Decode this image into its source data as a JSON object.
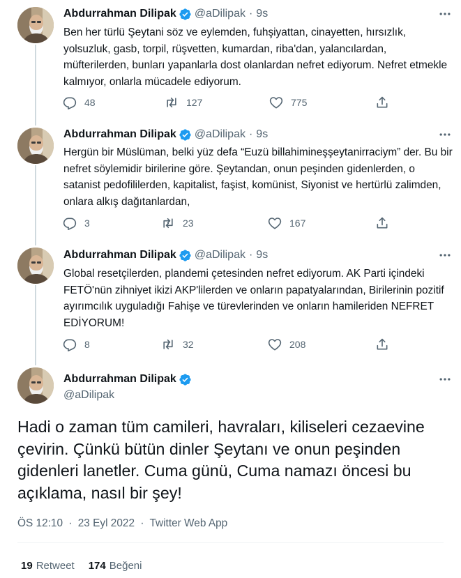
{
  "author": {
    "name": "Abdurrahman Dilipak",
    "handle": "@aDilipak"
  },
  "colors": {
    "verified": "#1d9bf0",
    "text_primary": "#0f1419",
    "text_secondary": "#536471",
    "divider": "#eff3f4",
    "thread_line": "#cfd9de"
  },
  "tweets": [
    {
      "time": "9s",
      "text": "Ben her türlü Şeytani söz ve eylemden, fuhşiyattan, cinayetten, hırsızlık, yolsuzluk, gasb, torpil, rüşvetten, kumardan, riba'dan, yalancılardan, müfterilerden,  bunları yapanlarla dost olanlardan nefret ediyorum. Nefret etmekle kalmıyor, onlarla mücadele ediyorum.",
      "replies": "48",
      "retweets": "127",
      "likes": "775"
    },
    {
      "time": "9s",
      "text": "Hergün bir Müslüman, belki yüz defa “Euzü billahimineşşeytanirraciym” der. Bu bir nefret söylemidir birilerine göre. Şeytandan, onun peşinden gidenlerden, o satanist pedofililerden, kapitalist, faşist, komünist, Siyonist ve hertürlü zalimden, onlara alkış dağıtanlardan,",
      "replies": "3",
      "retweets": "23",
      "likes": "167"
    },
    {
      "time": "9s",
      "text": "Global resetçilerden, plandemi çetesinden  nefret ediyorum. AK Parti içindeki FETÖ'nün zihniyet ikizi AKP'lilerden ve onların papatyalarından, Birilerinin pozitif ayırımcılık uyguladığı Fahişe ve türevlerinden ve onların hamileriden NEFRET EDİYORUM!",
      "replies": "8",
      "retweets": "32",
      "likes": "208"
    }
  ],
  "main_tweet": {
    "text": "Hadi o zaman tüm camileri, havraları, kiliseleri cezaevine çevirin. Çünkü bütün dinler Şeytanı ve onun peşinden gidenleri lanetler. Cuma günü, Cuma namazı öncesi bu açıklama, nasıl bir şey!",
    "time": "ÖS 12:10",
    "date": "23 Eyl 2022",
    "source": "Twitter Web App",
    "separator": "·",
    "retweet_count": "19",
    "retweet_label": "Retweet",
    "like_count": "174",
    "like_label": "Beğeni"
  },
  "icons": [
    "verified-badge-icon",
    "more-icon",
    "reply-icon",
    "retweet-icon",
    "like-icon",
    "share-icon"
  ]
}
